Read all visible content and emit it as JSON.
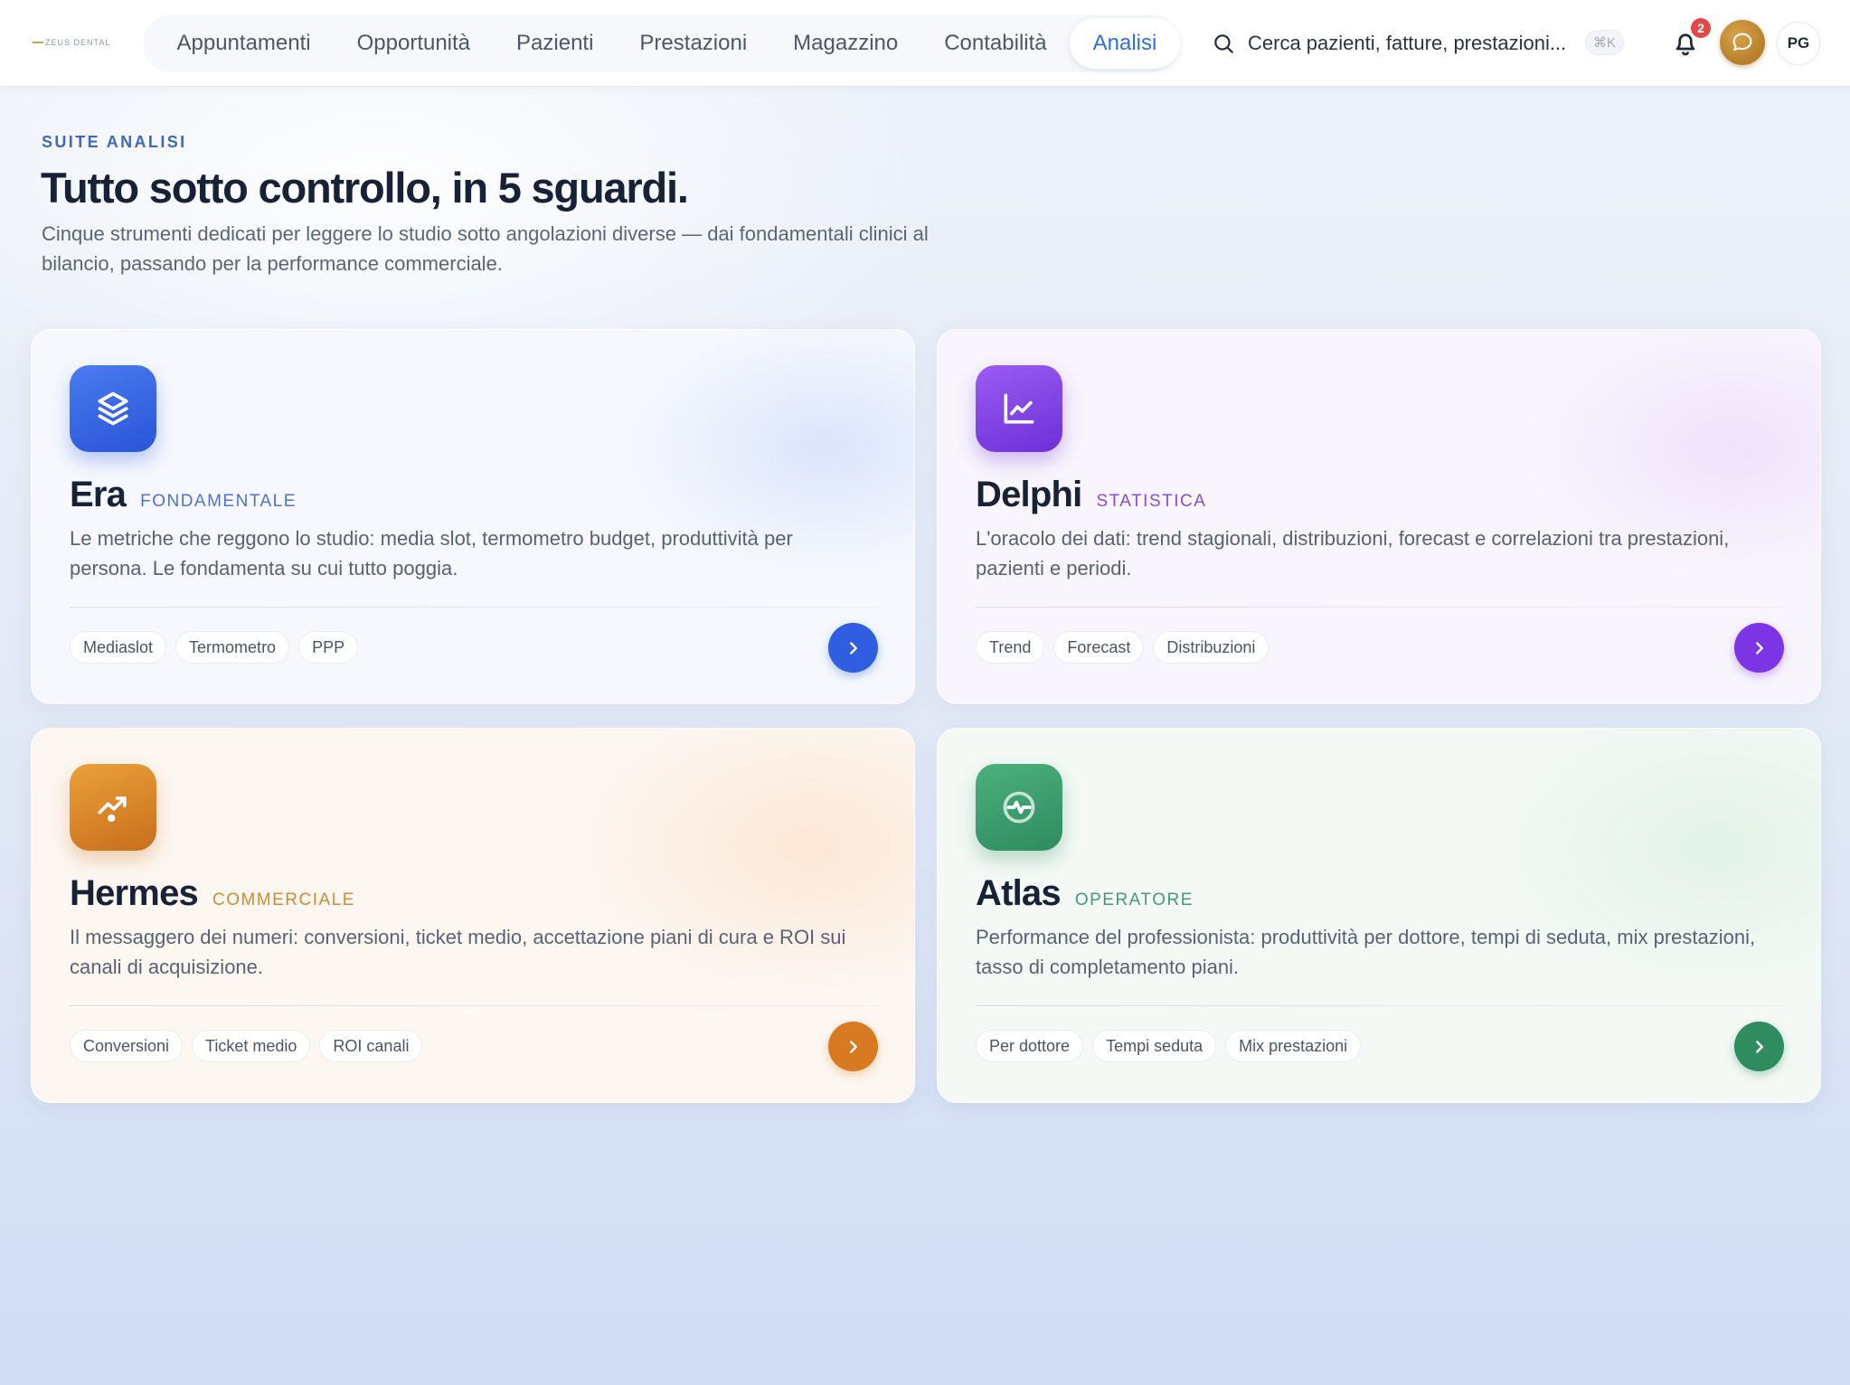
{
  "navbar": {
    "logo_text": "ZEUS DENTAL",
    "items": [
      {
        "label": "Appuntamenti",
        "active": false
      },
      {
        "label": "Opportunità",
        "active": false
      },
      {
        "label": "Pazienti",
        "active": false
      },
      {
        "label": "Prestazioni",
        "active": false
      },
      {
        "label": "Magazzino",
        "active": false
      },
      {
        "label": "Contabilità",
        "active": false
      },
      {
        "label": "Analisi",
        "active": true
      }
    ],
    "search_placeholder": "Cerca pazienti, fatture, prestazioni...",
    "search_shortcut": "⌘K",
    "notifications_count": "2",
    "user_initials": "PG",
    "accent_color": "#2f6fde"
  },
  "hero": {
    "eyebrow": "SUITE ANALISI",
    "title": "Tutto sotto controllo, in 5 sguardi.",
    "subtitle": "Cinque strumenti dedicati per leggere lo studio sotto angolazioni diverse — dai fondamentali clinici al bilancio, passando per la performance commerciale."
  },
  "cards": [
    {
      "title": "Era",
      "tag": "FONDAMENTALE",
      "description": "Le metriche che reggono lo studio: media slot, termometro budget, produttività per persona. Le fondamenta su cui tutto poggia.",
      "chips": [
        "Mediaslot",
        "Termometro",
        "PPP"
      ],
      "icon": "layers-icon",
      "color": "#2f5fe0"
    },
    {
      "title": "Delphi",
      "tag": "STATISTICA",
      "description": "L'oracolo dei dati: trend stagionali, distribuzioni, forecast e correlazioni tra prestazioni, pazienti e periodi.",
      "chips": [
        "Trend",
        "Forecast",
        "Distribuzioni"
      ],
      "icon": "line-chart-icon",
      "color": "#7b35e4"
    },
    {
      "title": "Hermes",
      "tag": "COMMERCIALE",
      "description": "Il messaggero dei numeri: conversioni, ticket medio, accettazione piani di cura e ROI sui canali di acquisizione.",
      "chips": [
        "Conversioni",
        "Ticket medio",
        "ROI canali"
      ],
      "icon": "trending-up-icon",
      "color": "#d77a22"
    },
    {
      "title": "Atlas",
      "tag": "OPERATORE",
      "description": "Performance del professionista: produttività per dottore, tempi di seduta, mix prestazioni, tasso di completamento piani.",
      "chips": [
        "Per dottore",
        "Tempi seduta",
        "Mix prestazioni"
      ],
      "icon": "activity-icon",
      "color": "#2f8c5f"
    }
  ]
}
